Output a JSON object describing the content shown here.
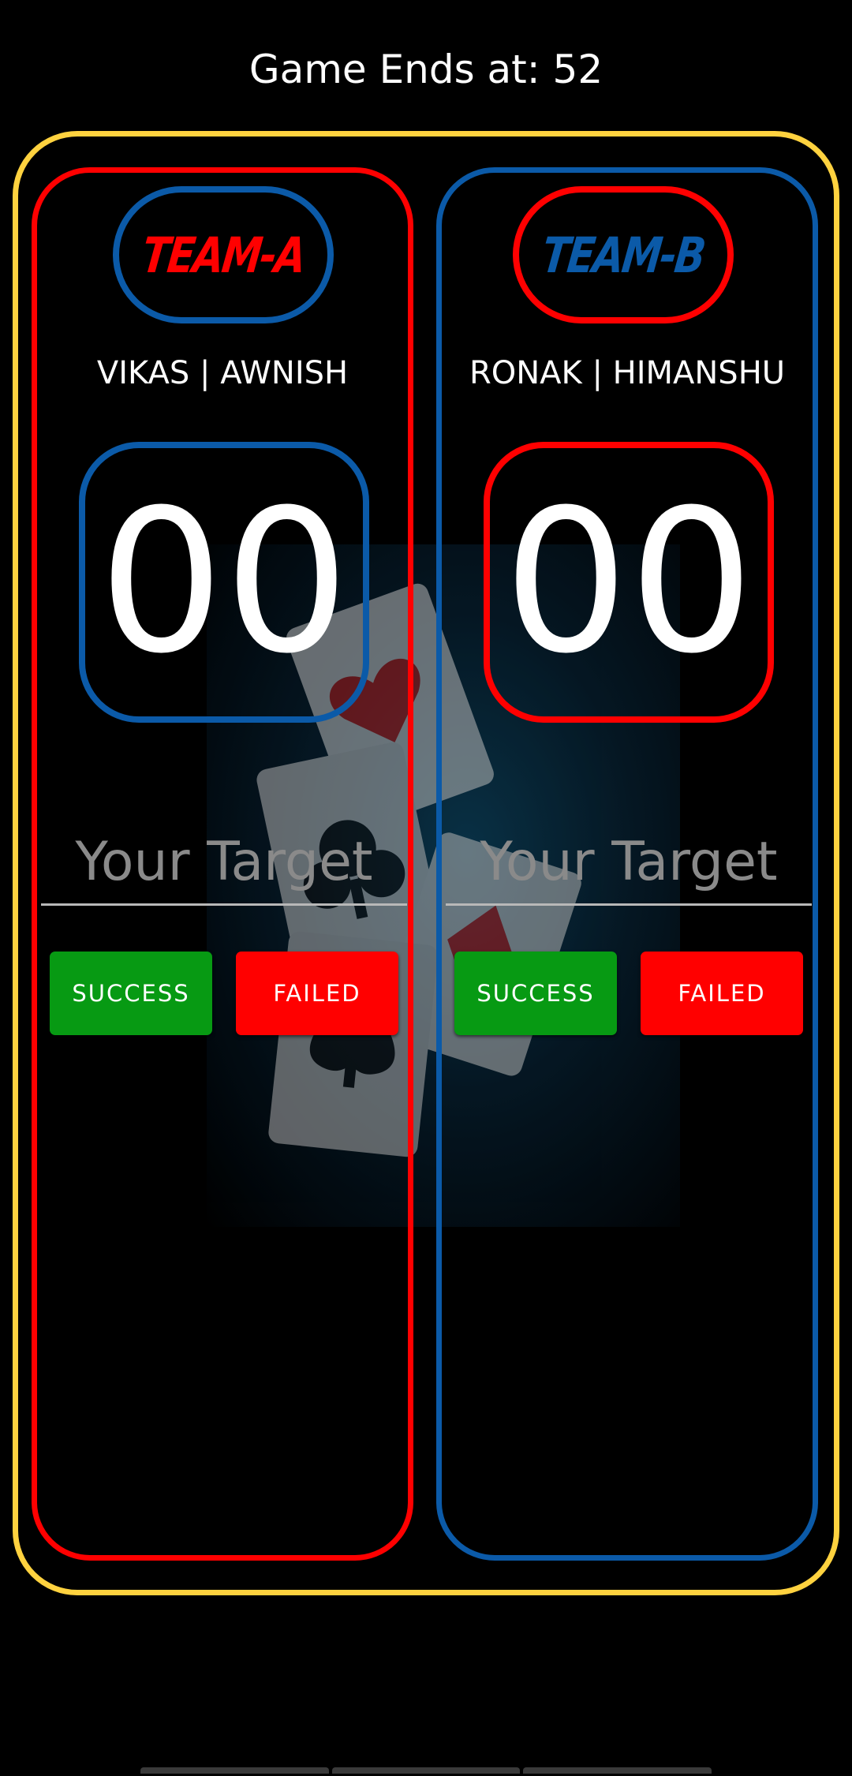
{
  "header": {
    "title": "Game Ends at: 52"
  },
  "teams": [
    {
      "name": "TEAM-A",
      "players": "VIKAS | AWNISH",
      "score": "00",
      "target_placeholder": "Your Target",
      "success_label": "SUCCESS",
      "failed_label": "FAILED"
    },
    {
      "name": "TEAM-B",
      "players": "RONAK | HIMANSHU",
      "score": "00",
      "target_placeholder": "Your Target",
      "success_label": "SUCCESS",
      "failed_label": "FAILED"
    }
  ],
  "colors": {
    "outer_frame": "#ffd23f",
    "team_a": "#ff0000",
    "team_b": "#0b5aa8",
    "success": "#079a13",
    "failed": "#ff0000",
    "background": "#000000"
  }
}
